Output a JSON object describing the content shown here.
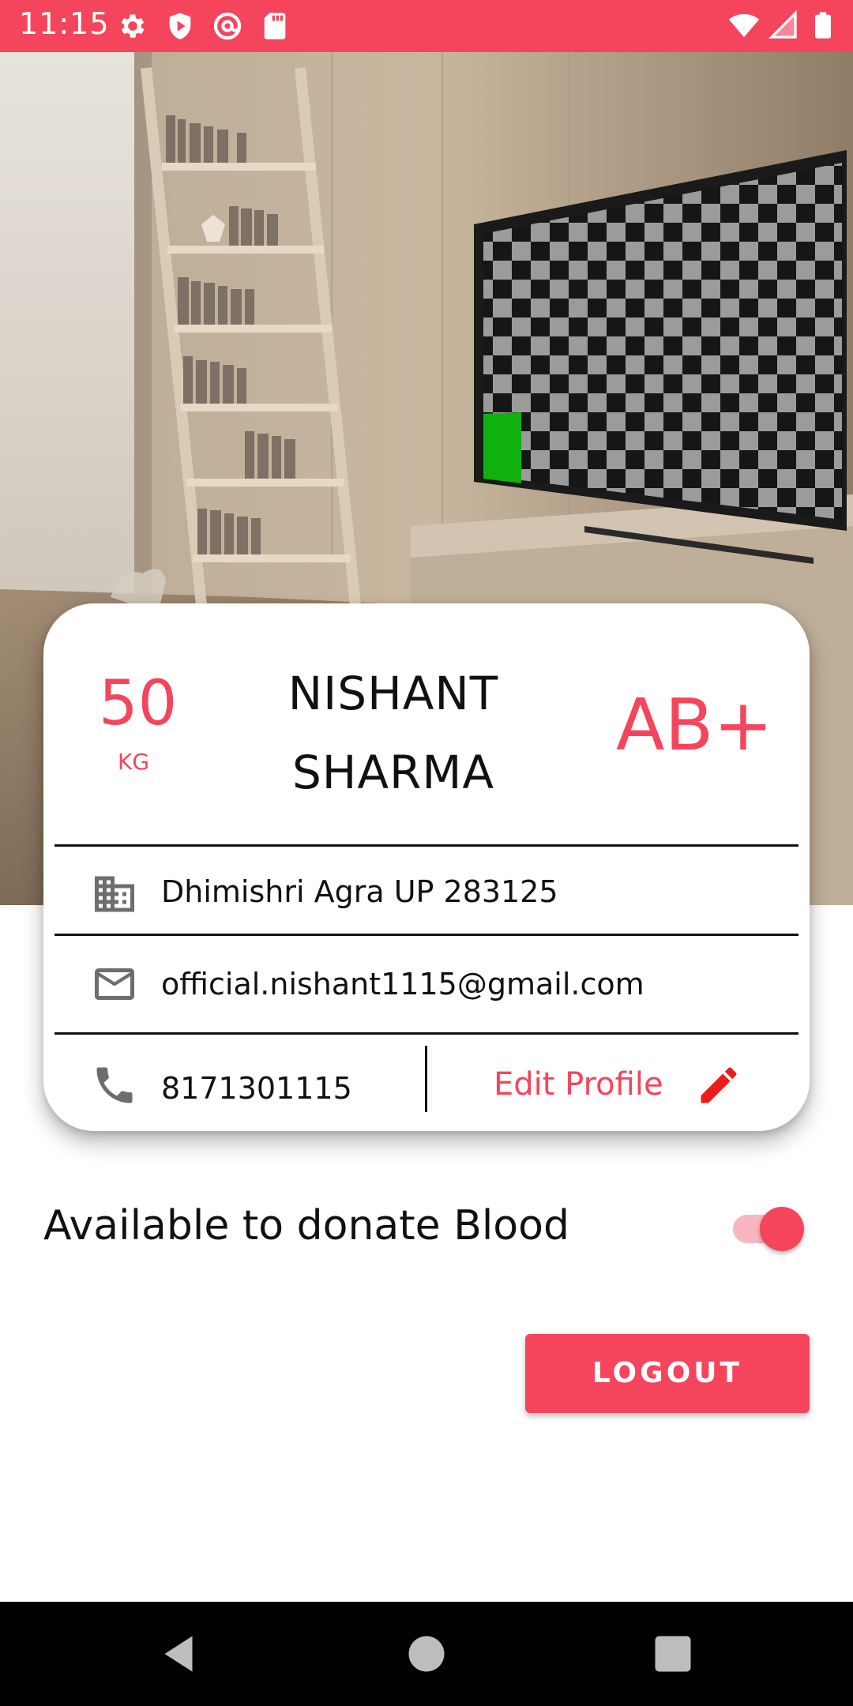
{
  "status_bar": {
    "time": "11:15",
    "left_icons": [
      "gear-icon",
      "shield-icon",
      "at-sign-icon",
      "sd-card-icon"
    ],
    "right_icons": [
      "wifi-icon",
      "signal-icon",
      "battery-icon"
    ],
    "color": "#f5455c"
  },
  "profile": {
    "weight_value": "50",
    "weight_unit": "KG",
    "name_first": "NISHANT",
    "name_last": "SHARMA",
    "blood_group": "AB+",
    "address": "Dhimishri Agra UP 283125",
    "email": "official.nishant1115@gmail.com",
    "phone": "8171301115",
    "edit_label": "Edit Profile"
  },
  "donate": {
    "label": "Available to donate Blood",
    "enabled": true
  },
  "logout_label": "LOGOUT",
  "colors": {
    "accent": "#f5455c",
    "toggle_track": "#f9b6c0",
    "text": "#111111"
  }
}
